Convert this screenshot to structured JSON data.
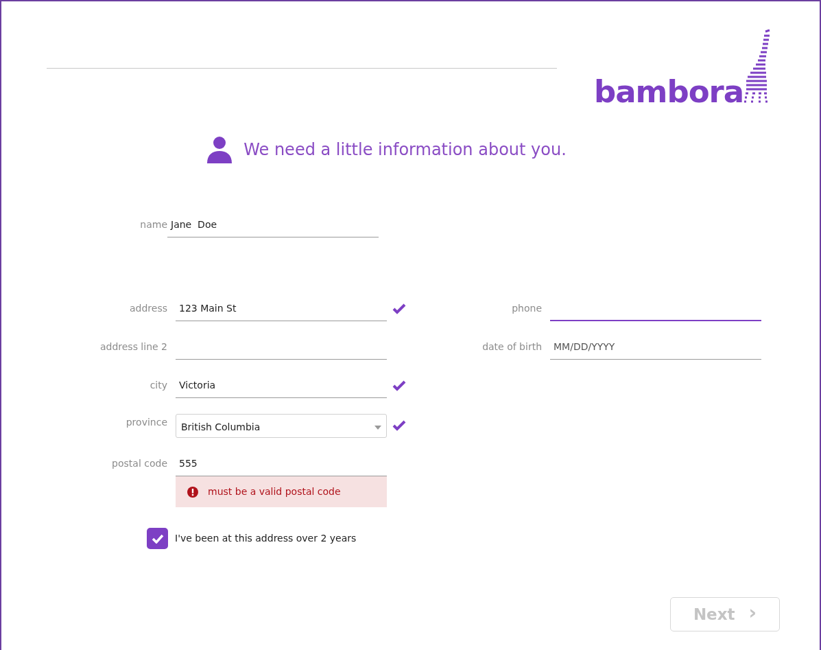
{
  "logo": {
    "text": "bambora"
  },
  "heading": "We need a little information about you.",
  "name_field": {
    "label": "name",
    "value": "Jane  Doe",
    "focused": false
  },
  "left_fields": [
    {
      "kind": "text",
      "label": "address",
      "value": "123 Main St",
      "valid": true,
      "focused": false
    },
    {
      "kind": "text",
      "label": "address line 2",
      "valid": false,
      "focused": false
    },
    {
      "kind": "text",
      "label": "city",
      "value": "Victoria",
      "valid": true,
      "focused": false
    },
    {
      "kind": "select",
      "label": "province",
      "value": "British Columbia",
      "valid": true,
      "focused": false
    },
    {
      "kind": "text",
      "label": "postal code",
      "value": "555",
      "valid": false,
      "focused": false,
      "error": "must be a valid postal code"
    }
  ],
  "right_fields": [
    {
      "label": "phone",
      "valid": false,
      "focused": true
    },
    {
      "label": "date of birth",
      "placeholder": "MM/DD/YYYY",
      "valid": false,
      "focused": false
    }
  ],
  "address_checkbox": {
    "label": "I've been at this address over 2 years",
    "checked": true
  },
  "next_button": {
    "label": "Next",
    "icon": "›",
    "disabled": true
  }
}
